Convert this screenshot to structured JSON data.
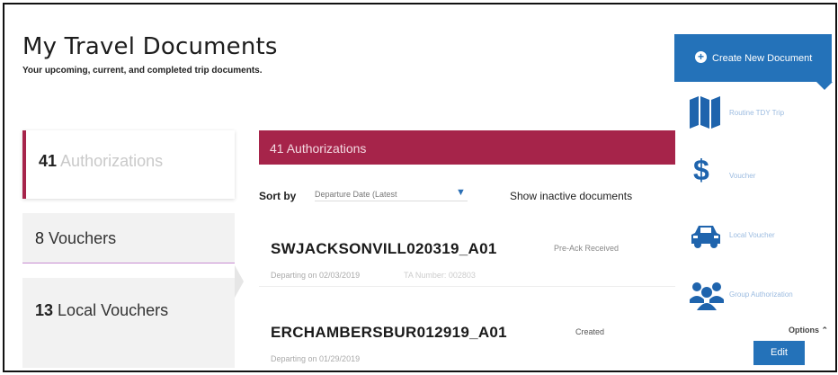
{
  "header": {
    "title": "My Travel Documents",
    "subtitle": "Your upcoming, current, and completed trip documents."
  },
  "sidebar": {
    "items": [
      {
        "count": "41",
        "label": "Authorizations"
      },
      {
        "count": "8",
        "label": "Vouchers"
      },
      {
        "count": "13",
        "label": "Local Vouchers"
      }
    ]
  },
  "main": {
    "section_title": "41 Authorizations",
    "sort_label": "Sort by",
    "sort_value": "Departure Date (Latest",
    "show_inactive": "Show inactive documents",
    "documents": [
      {
        "name": "SWJACKSONVILL020319_A01",
        "status": "Pre-Ack Received",
        "departing": "Departing on 02/03/2019",
        "extra": "TA Number: 002803"
      },
      {
        "name": "ERCHAMBERSBUR012919_A01",
        "status": "Created",
        "departing": "Departing on 01/29/2019"
      }
    ],
    "options_label": "Options",
    "edit_label": "Edit"
  },
  "actions": {
    "create_label": "Create New Document",
    "items": [
      {
        "label": "Routine TDY Trip",
        "icon": "map-icon"
      },
      {
        "label": "Voucher",
        "icon": "dollar-icon"
      },
      {
        "label": "Local Voucher",
        "icon": "car-icon"
      },
      {
        "label": "Group Authorization",
        "icon": "group-icon"
      }
    ]
  },
  "colors": {
    "accent": "#a6244a",
    "primary": "#2472b9"
  }
}
